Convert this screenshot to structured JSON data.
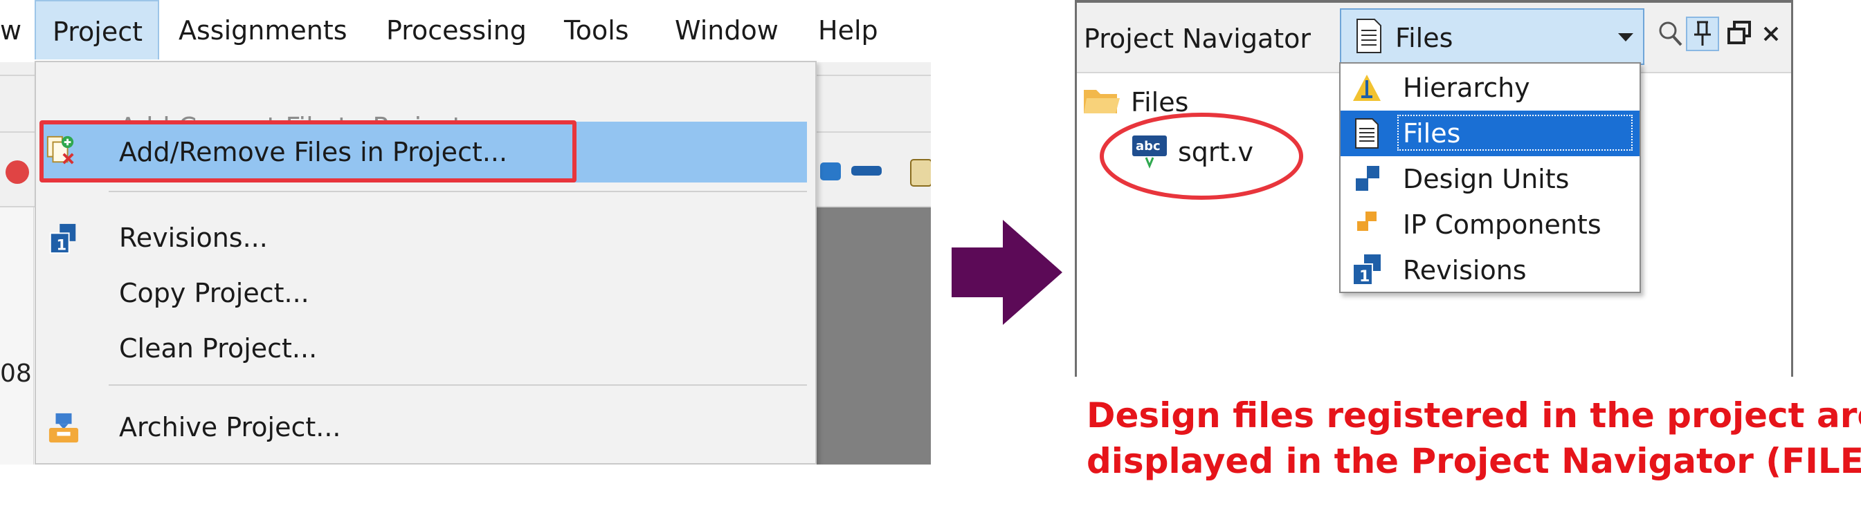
{
  "menu_bar": {
    "items": [
      {
        "label": "w"
      },
      {
        "label": "Project"
      },
      {
        "label": "Assignments"
      },
      {
        "label": "Processing"
      },
      {
        "label": "Tools"
      },
      {
        "label": "Window"
      },
      {
        "label": "Help"
      }
    ]
  },
  "background": {
    "row_number": "08"
  },
  "project_menu": {
    "items": [
      {
        "label": "Add Current File to Project",
        "state": "disabled"
      },
      {
        "label": "Add/Remove Files in Project...",
        "state": "highlighted",
        "icon": "add-remove-files-icon"
      },
      {
        "label": "Revisions...",
        "icon": "revisions-icon"
      },
      {
        "label": "Copy Project..."
      },
      {
        "label": "Clean Project..."
      },
      {
        "label": "Archive Project...",
        "icon": "archive-icon"
      }
    ]
  },
  "navigator": {
    "title": "Project Navigator",
    "selector_value": "Files",
    "tree": [
      {
        "label": "Files",
        "icon": "folder-icon"
      },
      {
        "label": "sqrt.v",
        "icon": "verilog-file-icon"
      }
    ],
    "options": [
      {
        "label": "Hierarchy",
        "icon": "hierarchy-icon"
      },
      {
        "label": "Files",
        "icon": "files-icon",
        "selected": true
      },
      {
        "label": "Design Units",
        "icon": "design-units-icon"
      },
      {
        "label": "IP Components",
        "icon": "ip-components-icon"
      },
      {
        "label": "Revisions",
        "icon": "revisions-icon"
      }
    ]
  },
  "caption": {
    "line1": "Design files registered in the project are",
    "line2": "displayed in the Project Navigator (FILE)."
  },
  "colors": {
    "highlight": "#93c4f1",
    "selected_option": "#1a6fd4",
    "annotation_red": "#e8353c",
    "arrow": "#5c0a57",
    "caption": "#e6141a"
  }
}
